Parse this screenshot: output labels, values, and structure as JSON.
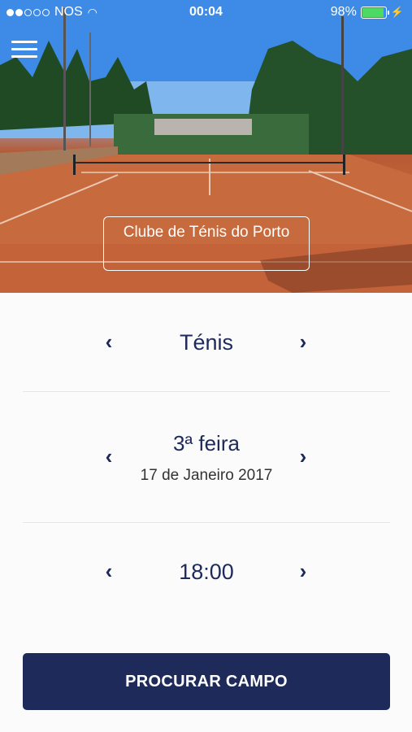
{
  "status_bar": {
    "carrier": "NOS",
    "time": "00:04",
    "battery": "98%",
    "battery_level": 0.98
  },
  "hero": {
    "club_name": "Clube de Ténis do Porto"
  },
  "sport": {
    "value": "Ténis"
  },
  "date": {
    "weekday": "3ª feira",
    "full_date": "17 de Janeiro 2017"
  },
  "time": {
    "value": "18:00"
  },
  "actions": {
    "search_label": "PROCURAR CAMPO"
  },
  "icons": {
    "menu": "hamburger-menu-icon",
    "prev": "chevron-left-icon",
    "next": "chevron-right-icon"
  },
  "colors": {
    "primary": "#1e2a5a",
    "background": "#fbfbfc"
  }
}
